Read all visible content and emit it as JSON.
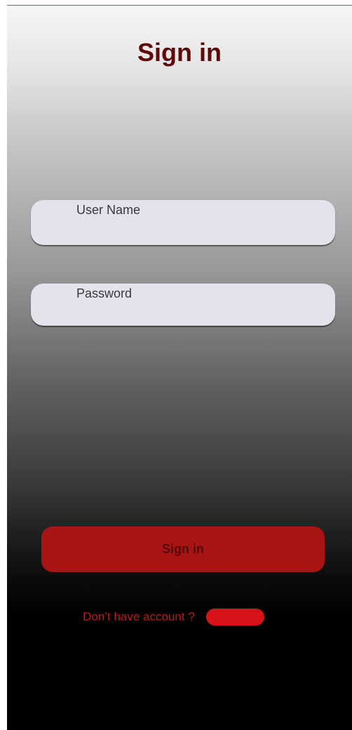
{
  "screen": {
    "title": "Sign in"
  },
  "form": {
    "username_label": "User Name",
    "password_label": "Password",
    "submit_label": "Sign in"
  },
  "footer": {
    "prompt_text": "Don’t have account ?"
  },
  "colors": {
    "title": "#5e0a0a",
    "field_background": "#e5e2ee",
    "button_background": "#a81414",
    "button_text": "#560808",
    "prompt_text": "#c1161a",
    "signup_pill": "#d6131b"
  }
}
